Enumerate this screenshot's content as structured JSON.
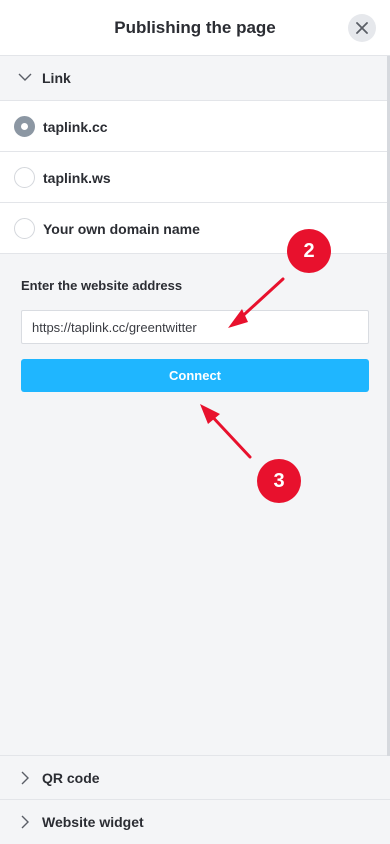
{
  "header": {
    "title": "Publishing the page",
    "close_icon": "close-icon"
  },
  "link_section": {
    "label": "Link",
    "icon": "chevron-down-icon"
  },
  "domain_options": [
    {
      "label": "taplink.cc",
      "selected": true
    },
    {
      "label": "taplink.ws",
      "selected": false
    },
    {
      "label": "Your own domain name",
      "selected": false
    }
  ],
  "form": {
    "label": "Enter the website address",
    "value": "https://taplink.cc/greentwitter",
    "connect_label": "Connect"
  },
  "annotations": {
    "step2": "2",
    "step3": "3",
    "color": "#e8112d"
  },
  "qr_section": {
    "label": "QR code",
    "icon": "chevron-right-icon"
  },
  "widget_section": {
    "label": "Website widget",
    "icon": "chevron-right-icon"
  },
  "colors": {
    "accent": "#1fb6ff",
    "annotation": "#e8112d",
    "radio_selected": "#8c97a3"
  }
}
